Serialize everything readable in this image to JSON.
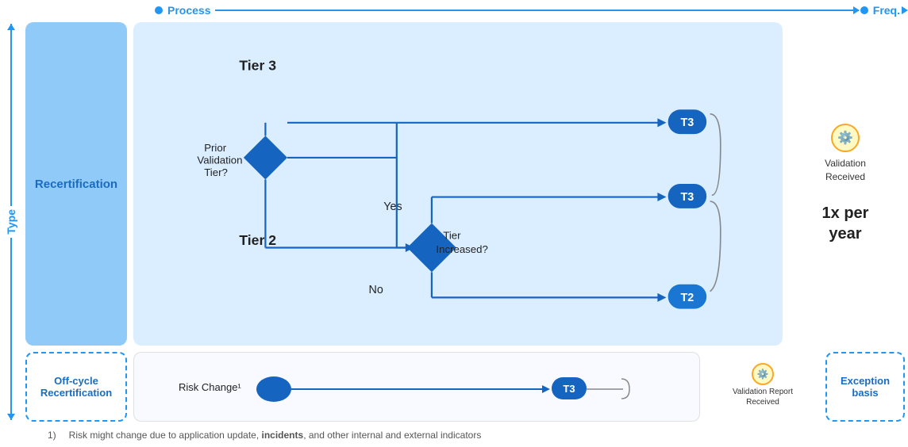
{
  "header": {
    "process_label": "Process",
    "freq_label": "Freq.",
    "type_label": "Type"
  },
  "main": {
    "recertification_label": "Recertification",
    "off_cycle_label": "Off-cycle Recertification",
    "per_year": "1x per\nyear",
    "exception_basis": "Exception basis",
    "validation_received": "Validation\nReceived",
    "validation_report": "Validation Report\nReceived"
  },
  "flow": {
    "tier3_label": "Tier 3",
    "tier2_label": "Tier 2",
    "yes_label": "Yes",
    "no_label": "No",
    "prior_validation": "Prior\nValidation\nTier?",
    "tier_increased": "Tier\nIncreased?",
    "risk_change": "Risk Change¹",
    "t3_badge": "T3",
    "t2_badge": "T2"
  },
  "footnote": {
    "number": "1)",
    "text": "Risk might change due to application update, ",
    "bold": "incidents",
    "text2": ", and other internal and external indicators"
  }
}
